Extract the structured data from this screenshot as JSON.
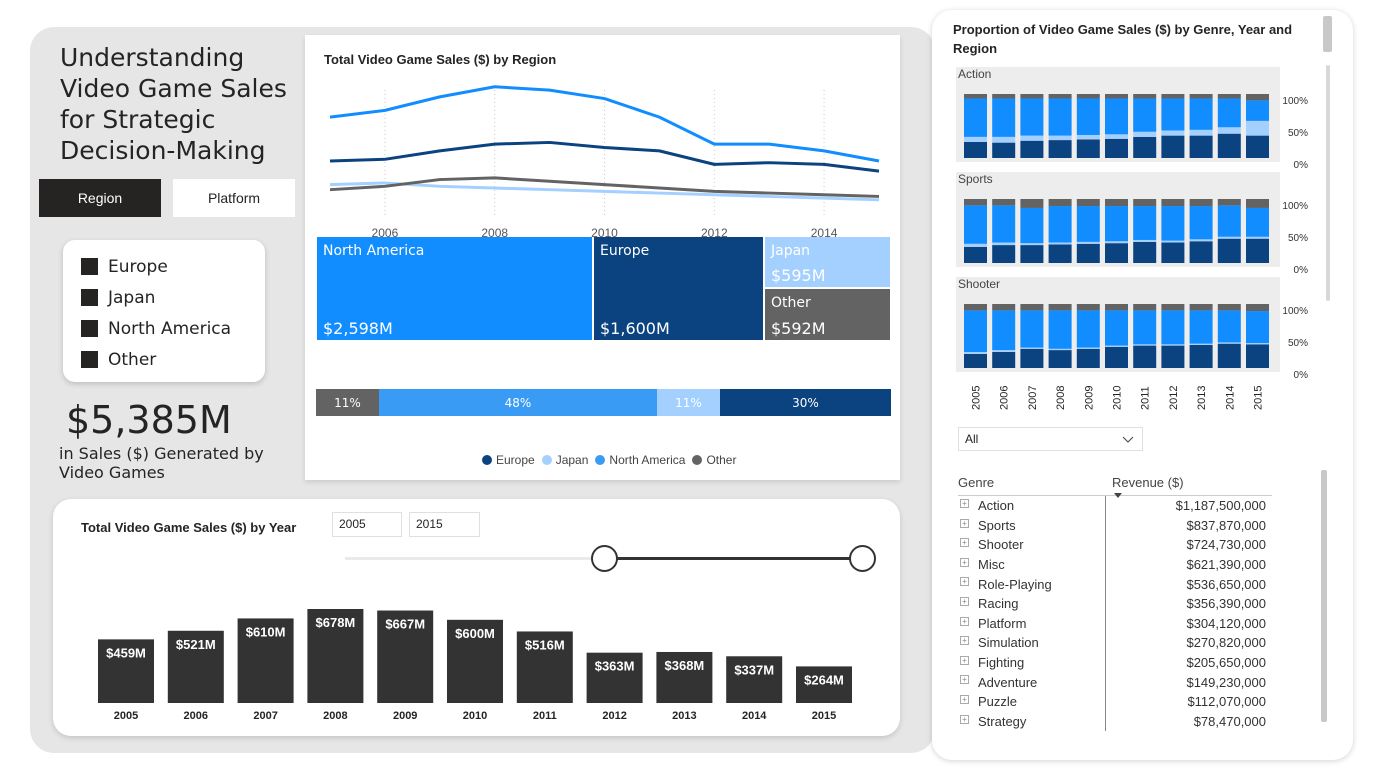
{
  "title": "Understanding Video Game Sales for Strategic Decision-Making",
  "toggles": {
    "region": "Region",
    "platform": "Platform"
  },
  "legend": {
    "items": [
      "Europe",
      "Japan",
      "North America",
      "Other"
    ]
  },
  "kpi": {
    "value": "$5,385M",
    "label": "in Sales ($) Generated by Video Games"
  },
  "colors": {
    "north_america": "#118dff",
    "europe": "#0b4380",
    "japan": "#a3d0ff",
    "other": "#636363",
    "dark": "#252423"
  },
  "region_card": {
    "line_title": "Total Video Game Sales ($) by Region",
    "treemap": {
      "north_america": {
        "label": "North America",
        "value": "$2,598M"
      },
      "europe": {
        "label": "Europe",
        "value": "$1,600M"
      },
      "japan": {
        "label": "Japan",
        "value": "$595M"
      },
      "other": {
        "label": "Other",
        "value": "$592M"
      }
    },
    "stacked_bar": {
      "other": "11%",
      "north_america": "48%",
      "japan": "11%",
      "europe": "30%"
    },
    "bottom_legend": [
      "Europe",
      "Japan",
      "North America",
      "Other"
    ]
  },
  "year_card": {
    "title": "Total Video Game Sales ($) by Year",
    "start": "2005",
    "end": "2015"
  },
  "right_panel": {
    "title": "Proportion of Video Game Sales ($) by Genre, Year and Region",
    "multiples": [
      "Action",
      "Sports",
      "Shooter"
    ],
    "pct_labels": [
      "100%",
      "50%",
      "0%"
    ],
    "dropdown": "All",
    "table": {
      "col_genre": "Genre",
      "col_revenue": "Revenue ($)",
      "rows": [
        {
          "genre": "Action",
          "revenue": "$1,187,500,000"
        },
        {
          "genre": "Sports",
          "revenue": "$837,870,000"
        },
        {
          "genre": "Shooter",
          "revenue": "$724,730,000"
        },
        {
          "genre": "Misc",
          "revenue": "$621,390,000"
        },
        {
          "genre": "Role-Playing",
          "revenue": "$536,650,000"
        },
        {
          "genre": "Racing",
          "revenue": "$356,390,000"
        },
        {
          "genre": "Platform",
          "revenue": "$304,120,000"
        },
        {
          "genre": "Simulation",
          "revenue": "$270,820,000"
        },
        {
          "genre": "Fighting",
          "revenue": "$205,650,000"
        },
        {
          "genre": "Adventure",
          "revenue": "$149,230,000"
        },
        {
          "genre": "Puzzle",
          "revenue": "$112,070,000"
        },
        {
          "genre": "Strategy",
          "revenue": "$78,470,000"
        }
      ]
    }
  },
  "chart_data": [
    {
      "type": "line",
      "title": "Total Video Game Sales ($) by Region",
      "x": [
        2005,
        2006,
        2007,
        2008,
        2009,
        2010,
        2011,
        2012,
        2013,
        2014,
        2015
      ],
      "x_tick_labels": [
        "2006",
        "2008",
        "2010",
        "2012",
        "2014"
      ],
      "series": [
        {
          "name": "North America",
          "color": "#118dff",
          "values": [
            290,
            310,
            350,
            380,
            370,
            345,
            290,
            210,
            210,
            190,
            160
          ]
        },
        {
          "name": "Europe",
          "color": "#0b4380",
          "values": [
            160,
            165,
            190,
            210,
            215,
            200,
            190,
            150,
            155,
            150,
            130
          ]
        },
        {
          "name": "Japan",
          "color": "#a3d0ff",
          "values": [
            90,
            95,
            85,
            80,
            75,
            70,
            65,
            60,
            55,
            50,
            45
          ]
        },
        {
          "name": "Other",
          "color": "#636363",
          "values": [
            75,
            85,
            105,
            110,
            100,
            90,
            80,
            70,
            65,
            60,
            55
          ]
        }
      ],
      "grid": true
    },
    {
      "type": "bar",
      "title": "Total Video Game Sales ($) by Year",
      "categories": [
        "2005",
        "2006",
        "2007",
        "2008",
        "2009",
        "2010",
        "2011",
        "2012",
        "2013",
        "2014",
        "2015"
      ],
      "values": [
        459,
        521,
        610,
        678,
        667,
        600,
        516,
        363,
        368,
        337,
        264
      ],
      "labels": [
        "$459M",
        "$521M",
        "$610M",
        "$678M",
        "$667M",
        "$600M",
        "$516M",
        "$363M",
        "$368M",
        "$337M",
        "$264M"
      ],
      "color": "#333333"
    },
    {
      "type": "bar",
      "title": "Proportion of Video Game Sales ($) by Genre, Year and Region",
      "stacked": "100%",
      "categories": [
        "2005",
        "2006",
        "2007",
        "2008",
        "2009",
        "2010",
        "2011",
        "2012",
        "2013",
        "2014",
        "2015"
      ],
      "panels": [
        {
          "name": "Action",
          "europe": [
            0.25,
            0.24,
            0.27,
            0.28,
            0.29,
            0.3,
            0.33,
            0.35,
            0.35,
            0.38,
            0.35
          ],
          "japan": [
            0.08,
            0.09,
            0.08,
            0.07,
            0.07,
            0.07,
            0.08,
            0.08,
            0.09,
            0.1,
            0.23
          ],
          "north_america": [
            0.6,
            0.6,
            0.58,
            0.58,
            0.57,
            0.56,
            0.52,
            0.5,
            0.49,
            0.45,
            0.32
          ],
          "other": [
            0.07,
            0.07,
            0.07,
            0.07,
            0.07,
            0.07,
            0.07,
            0.07,
            0.07,
            0.07,
            0.1
          ]
        },
        {
          "name": "Sports",
          "europe": [
            0.25,
            0.28,
            0.28,
            0.29,
            0.3,
            0.31,
            0.33,
            0.32,
            0.34,
            0.38,
            0.38
          ],
          "japan": [
            0.05,
            0.04,
            0.03,
            0.03,
            0.03,
            0.03,
            0.03,
            0.03,
            0.03,
            0.03,
            0.03
          ],
          "north_america": [
            0.6,
            0.58,
            0.55,
            0.57,
            0.56,
            0.55,
            0.53,
            0.54,
            0.52,
            0.49,
            0.45
          ],
          "other": [
            0.1,
            0.1,
            0.14,
            0.11,
            0.11,
            0.11,
            0.11,
            0.11,
            0.11,
            0.1,
            0.14
          ]
        },
        {
          "name": "Shooter",
          "europe": [
            0.22,
            0.25,
            0.3,
            0.28,
            0.3,
            0.33,
            0.35,
            0.35,
            0.36,
            0.38,
            0.37
          ],
          "japan": [
            0.03,
            0.03,
            0.02,
            0.02,
            0.02,
            0.02,
            0.02,
            0.02,
            0.02,
            0.02,
            0.02
          ],
          "north_america": [
            0.65,
            0.62,
            0.58,
            0.6,
            0.58,
            0.55,
            0.53,
            0.53,
            0.52,
            0.5,
            0.5
          ],
          "other": [
            0.1,
            0.1,
            0.1,
            0.1,
            0.1,
            0.1,
            0.1,
            0.1,
            0.1,
            0.1,
            0.11
          ]
        }
      ]
    }
  ]
}
